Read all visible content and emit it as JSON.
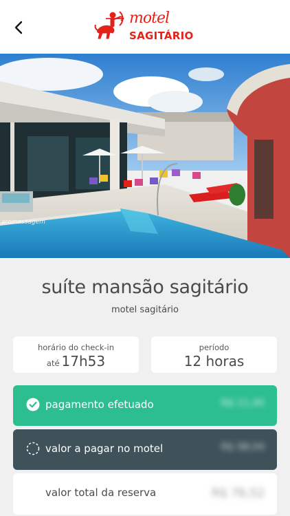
{
  "header": {
    "back_icon": "chevron-left-icon",
    "logo": {
      "script_text": "motel",
      "name_text": "SAGITÁRIO",
      "icon": "archer-centaur-icon",
      "brand_color": "#e2231a"
    }
  },
  "hero": {
    "watermark": "aromassagem"
  },
  "suite": {
    "title": "suíte mansão sagitário",
    "motel_name": "motel sagitário"
  },
  "checkin": {
    "label": "horário do check-in",
    "prefix": "até",
    "value": "17h53"
  },
  "period": {
    "label": "período",
    "value": "12 horas"
  },
  "payments": {
    "paid": {
      "label": "pagamento efetuado",
      "amount": "R$ 11,40",
      "icon": "check-circle-icon",
      "color": "#2dbe8f"
    },
    "due": {
      "label": "valor a pagar no motel",
      "amount": "R$ 98,04",
      "icon": "dashed-circle-icon",
      "color": "#3f525a"
    },
    "total": {
      "label": "valor total da reserva",
      "amount": "R$ 76,52"
    }
  }
}
